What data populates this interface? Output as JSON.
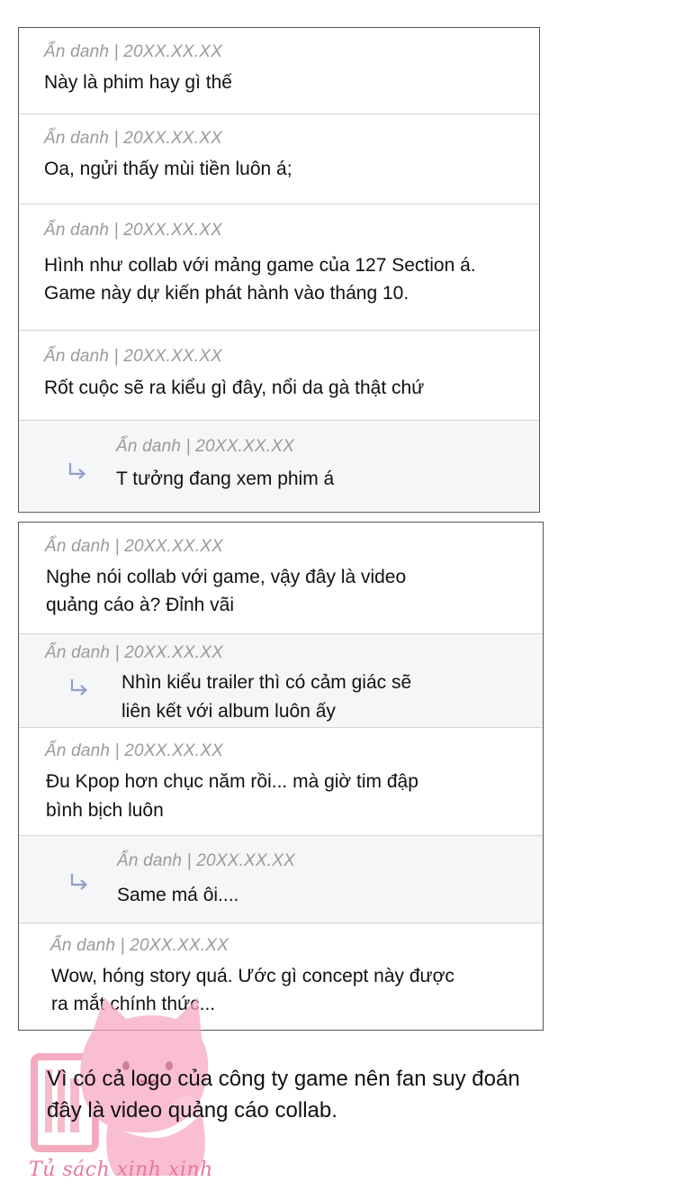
{
  "panel1": {
    "comments": [
      {
        "author": "Ẩn danh",
        "date": "20XX.XX.XX",
        "lines": [
          "Này là phim hay gì thế"
        ],
        "is_reply": false
      },
      {
        "author": "Ẩn danh",
        "date": "20XX.XX.XX",
        "lines": [
          "Oa, ngửi thấy mùi tiền luôn á;"
        ],
        "is_reply": false
      },
      {
        "author": "Ẩn danh",
        "date": "20XX.XX.XX",
        "lines": [
          "Hình như collab với mảng game của 127 Section á.",
          "Game này dự kiến phát hành vào tháng 10."
        ],
        "is_reply": false
      },
      {
        "author": "Ẩn danh",
        "date": "20XX.XX.XX",
        "lines": [
          "Rốt cuộc sẽ ra kiểu gì đây, nổi da gà thật chứ"
        ],
        "is_reply": false
      },
      {
        "author": "Ẩn danh",
        "date": "20XX.XX.XX",
        "lines": [
          "T tưởng đang xem phim á"
        ],
        "is_reply": true
      }
    ]
  },
  "panel2": {
    "comments": [
      {
        "author": "Ẩn danh",
        "date": "20XX.XX.XX",
        "lines": [
          "Nghe nói collab với game, vậy đây là video",
          "quảng cáo à? Đỉnh vãi"
        ],
        "is_reply": false
      },
      {
        "author": "Ẩn danh",
        "date": "20XX.XX.XX",
        "lines": [
          "Nhìn kiểu trailer thì có cảm giác sẽ",
          "liên kết với album luôn ấy"
        ],
        "is_reply": true
      },
      {
        "author": "Ẩn danh",
        "date": "20XX.XX.XX",
        "lines": [
          "Đu Kpop hơn chục năm rồi... mà giờ tim đập",
          "bình bịch luôn"
        ],
        "is_reply": false
      },
      {
        "author": "Ẩn danh",
        "date": "20XX.XX.XX",
        "lines": [
          "Same má ôi...."
        ],
        "is_reply": true
      },
      {
        "author": "Ẩn danh",
        "date": "20XX.XX.XX",
        "lines": [
          "Wow, hóng story quá. Ước gì concept này được",
          "ra mắt chính thức..."
        ],
        "is_reply": false
      }
    ]
  },
  "caption": {
    "lines": [
      "Vì có cả logo của công ty game nên fan suy đoán",
      "đây là video quảng cáo collab."
    ]
  },
  "watermark": {
    "text": "Tủ sách xinh xinh",
    "icon": "pink-cat-bookshelf-logo",
    "color": "#e8779a"
  },
  "icons": {
    "reply": "reply-arrow-icon"
  },
  "colors": {
    "meta_text": "#9a9a9a",
    "reply_bg": "#f5f6f8",
    "border": "#555555",
    "separator": "#d4d4d4"
  }
}
